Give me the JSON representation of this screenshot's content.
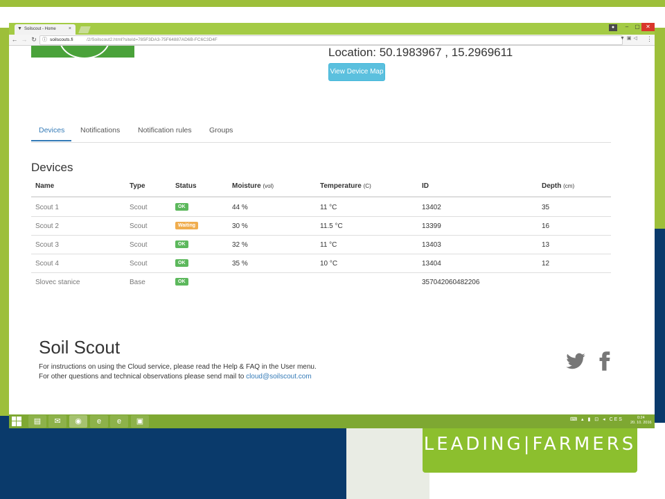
{
  "browser": {
    "tab_title": "Soilscout - Home",
    "tab_close": "×",
    "url_host": "soilscouts.fi",
    "url_path": "/2/Soilscout2.html?siteId=785F3DA3-75F64887AD6B-FC6C3D4F",
    "window_min": "–",
    "window_max": "▢",
    "window_close": "✕",
    "menu": "⋮"
  },
  "header": {
    "location": "Location: 50.1983967 , 15.2969611",
    "map_button": "View Device Map"
  },
  "tabs": [
    {
      "label": "Devices",
      "active": true
    },
    {
      "label": "Notifications"
    },
    {
      "label": "Notification rules"
    },
    {
      "label": "Groups"
    }
  ],
  "devices": {
    "title": "Devices",
    "columns": [
      {
        "label": "Name",
        "unit": ""
      },
      {
        "label": "Type",
        "unit": ""
      },
      {
        "label": "Status",
        "unit": ""
      },
      {
        "label": "Moisture",
        "unit": "(vol)"
      },
      {
        "label": "Temperature",
        "unit": "(C)"
      },
      {
        "label": "ID",
        "unit": ""
      },
      {
        "label": "Depth",
        "unit": "(cm)"
      }
    ],
    "rows": [
      {
        "name": "Scout 1",
        "type": "Scout",
        "status": "OK",
        "moisture": "44 %",
        "temperature": "11 °C",
        "id": "13402",
        "depth": "35"
      },
      {
        "name": "Scout 2",
        "type": "Scout",
        "status": "Waiting",
        "moisture": "30 %",
        "temperature": "11.5 °C",
        "id": "13399",
        "depth": "16"
      },
      {
        "name": "Scout 3",
        "type": "Scout",
        "status": "OK",
        "moisture": "32 %",
        "temperature": "11 °C",
        "id": "13403",
        "depth": "13"
      },
      {
        "name": "Scout 4",
        "type": "Scout",
        "status": "OK",
        "moisture": "35 %",
        "temperature": "10 °C",
        "id": "13404",
        "depth": "12"
      },
      {
        "name": "Slovec stanice",
        "type": "Base",
        "status": "OK",
        "moisture": "",
        "temperature": "",
        "id": "357042060482206",
        "depth": ""
      }
    ]
  },
  "footer": {
    "title": "Soil Scout",
    "line1": "For instructions on using the Cloud service, please read the Help & FAQ in the User menu.",
    "line2_prefix": "For other questions and technical observations please send mail to ",
    "email": "cloud@soilscout.com"
  },
  "taskbar": {
    "language": "CES",
    "time": "0:24",
    "date": "20. 10. 2016"
  },
  "slide": {
    "banner": "LEADING|FARMERS"
  },
  "colors": {
    "accent": "#337ab7",
    "ok": "#5cb85c",
    "waiting": "#f0ad4e",
    "info_button": "#5bc0de",
    "brand_green": "#9dbf3a"
  }
}
